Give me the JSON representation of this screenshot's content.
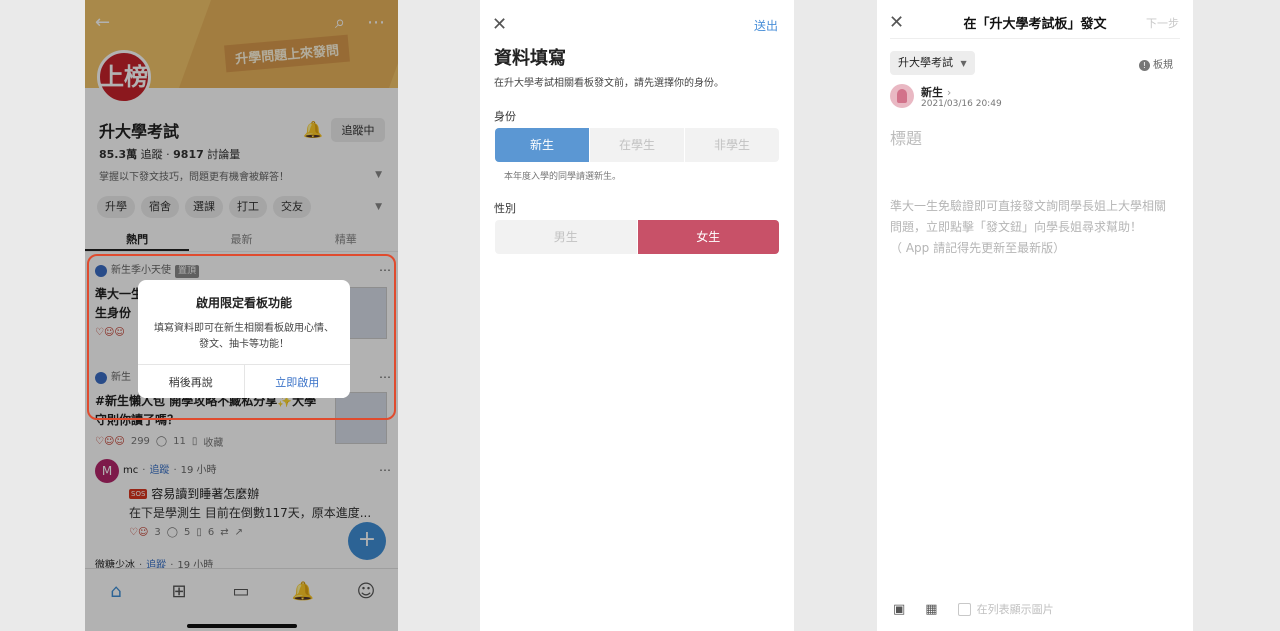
{
  "screen1": {
    "banner_sign": "升學問題上來發問",
    "logo_text": "上榜",
    "board_title": "升大學考試",
    "follow_button": "追蹤中",
    "stats": {
      "followers": "85.3萬",
      "followers_label": "追蹤",
      "discussions": "9817",
      "discussions_label": "討論量"
    },
    "description": "掌握以下發文技巧，問題更有機會被解答！",
    "tags": [
      "升學",
      "宿舍",
      "選課",
      "打工",
      "交友"
    ],
    "tabs": [
      "熱門",
      "最新",
      "精華"
    ],
    "posts": [
      {
        "author": "新生季小天使",
        "badge": "置頂",
        "line1": "準大一生",
        "line2": "生身份"
      },
      {
        "author": "新生",
        "title": "#新生懶人包 開學攻略不藏私分享✨大學",
        "title2": "守則你讀了嗎？",
        "likes": "299",
        "comments": "11",
        "save": "收藏"
      },
      {
        "author_initial": "M",
        "author": "mc",
        "follow": "追蹤",
        "time": "19 小時",
        "badge": "SOS",
        "title": "容易讀到睡著怎麼辦",
        "excerpt": "在下是學測生 目前在倒數117天，原本進度...",
        "likes": "3",
        "comments": "5",
        "saves": "6"
      },
      {
        "author": "微糖少冰",
        "follow": "追蹤",
        "time": "19 小時"
      }
    ],
    "dialog": {
      "title": "啟用限定看板功能",
      "body": "填寫資料即可在新生相關看板啟用心情、發文、抽卡等功能！",
      "later": "稍後再說",
      "enable": "立即啟用"
    }
  },
  "screen2": {
    "submit": "送出",
    "title": "資料填寫",
    "subtitle": "在升大學考試相關看板發文前，請先選擇你的身份。",
    "identity_label": "身份",
    "identity_options": [
      "新生",
      "在學生",
      "非學生"
    ],
    "identity_hint": "本年度入學的同學請選新生。",
    "gender_label": "性別",
    "gender_options": [
      "男生",
      "女生"
    ]
  },
  "screen3": {
    "title": "在「升大學考試板」發文",
    "next": "下一步",
    "board": "升大學考試",
    "rules": "板規",
    "user_name": "新生",
    "timestamp": "2021/03/16 20:49",
    "headline_placeholder": "標題",
    "body_placeholder_1": "準大一生免驗證即可直接發文詢問學長姐上大學相關",
    "body_placeholder_2": "問題，立即點擊「發文鈕」向學長姐尋求幫助！",
    "body_placeholder_3": "（ App 請記得先更新至最新版）",
    "show_image_option": "在列表顯示圖片"
  },
  "colors": {
    "accent_blue": "#5b97d3",
    "accent_red": "#c85168",
    "link_blue": "#4a8fd8",
    "highlight": "#e04b2e"
  }
}
